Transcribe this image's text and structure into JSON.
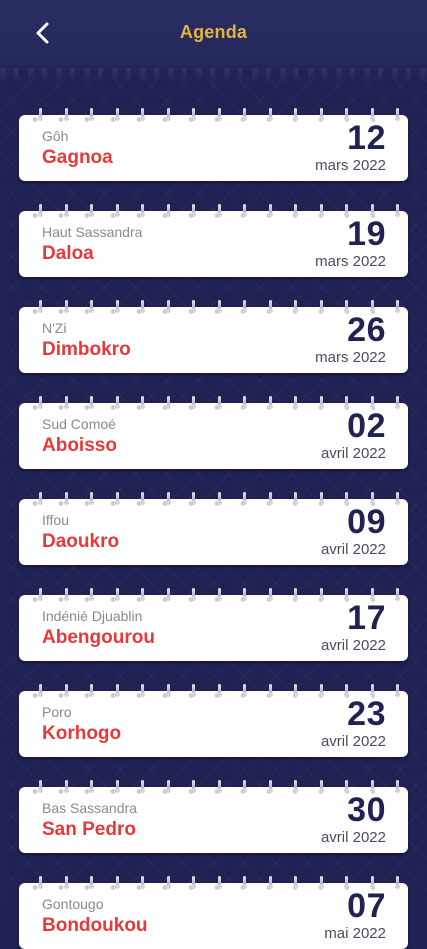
{
  "header": {
    "title": "Agenda",
    "back_icon": "chevron-left-icon",
    "title_color": "#e1b43f"
  },
  "theme": {
    "background": "#1f2252",
    "city_color": "#e63a3a",
    "day_color": "#1f2252"
  },
  "events": [
    {
      "region": "Gôh",
      "city": "Gagnoa",
      "day": "12",
      "month": "mars 2022"
    },
    {
      "region": "Haut Sassandra",
      "city": "Daloa",
      "day": "19",
      "month": "mars 2022"
    },
    {
      "region": "N'Zi",
      "city": "Dimbokro",
      "day": "26",
      "month": "mars 2022"
    },
    {
      "region": "Sud Comoé",
      "city": "Aboisso",
      "day": "02",
      "month": "avril 2022"
    },
    {
      "region": "Iffou",
      "city": "Daoukro",
      "day": "09",
      "month": "avril 2022"
    },
    {
      "region": "Indénié Djuablin",
      "city": "Abengourou",
      "day": "17",
      "month": "avril 2022"
    },
    {
      "region": "Poro",
      "city": "Korhogo",
      "day": "23",
      "month": "avril 2022"
    },
    {
      "region": "Bas Sassandra",
      "city": "San Pedro",
      "day": "30",
      "month": "avril 2022"
    },
    {
      "region": "Gontougo",
      "city": "Bondoukou",
      "day": "07",
      "month": "mai 2022"
    }
  ]
}
